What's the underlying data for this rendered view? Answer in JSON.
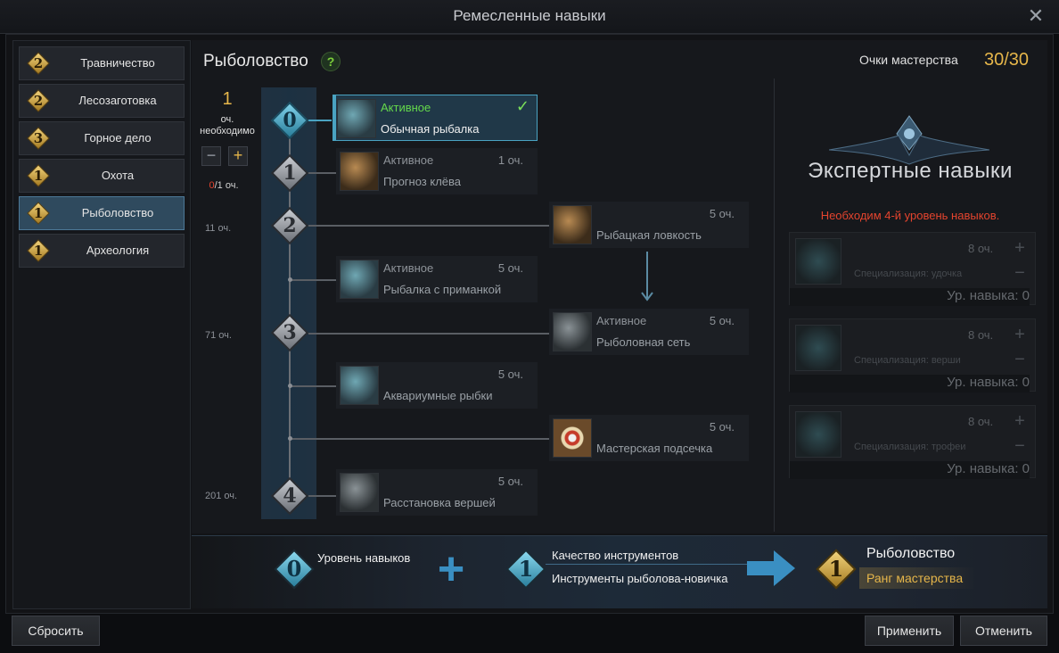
{
  "window": {
    "title": "Ремесленные навыки"
  },
  "sidebar": {
    "items": [
      {
        "level": "2",
        "label": "Травничество",
        "selected": false
      },
      {
        "level": "2",
        "label": "Лесозаготовка",
        "selected": false
      },
      {
        "level": "3",
        "label": "Горное дело",
        "selected": false
      },
      {
        "level": "1",
        "label": "Охота",
        "selected": false
      },
      {
        "level": "1",
        "label": "Рыболовство",
        "selected": true
      },
      {
        "level": "1",
        "label": "Археология",
        "selected": false
      }
    ]
  },
  "header": {
    "title": "Рыболовство",
    "help": "?",
    "mastery_label": "Очки мастерства",
    "mastery_value": "30/30"
  },
  "points": {
    "needed": "1",
    "needed_label": "оч. необходимо",
    "minus": "−",
    "plus": "+",
    "used_current": "0",
    "used_total": "/1 оч."
  },
  "tree": {
    "ranks": [
      "0",
      "1",
      "2",
      "3",
      "4"
    ],
    "requirements": [
      "11 оч.",
      "71 оч.",
      "201 оч."
    ],
    "skills": [
      {
        "type": "Активное",
        "name": "Обычная рыбалка",
        "cost": "",
        "active": true,
        "check": "✓"
      },
      {
        "type": "Активное",
        "name": "Прогноз клёва",
        "cost": "1 оч."
      },
      {
        "type": "",
        "name": "Рыбацкая ловкость",
        "cost": "5 оч."
      },
      {
        "type": "Активное",
        "name": "Рыбалка с приманкой",
        "cost": "5 оч."
      },
      {
        "type": "Активное",
        "name": "Рыболовная сеть",
        "cost": "5 оч."
      },
      {
        "type": "",
        "name": "Аквариумные рыбки",
        "cost": "5 оч."
      },
      {
        "type": "",
        "name": "Мастерская подсечка",
        "cost": "5 оч."
      },
      {
        "type": "",
        "name": "Расстановка вершей",
        "cost": "5 оч."
      }
    ]
  },
  "expert": {
    "title": "Экспертные навыки",
    "warning": "Необходим 4-й уровень навыков.",
    "cards": [
      {
        "cost": "8 оч.",
        "spec": "Специализация: удочка",
        "level": "Ур. навыка: 0",
        "plus": "+",
        "minus": "−"
      },
      {
        "cost": "8 оч.",
        "spec": "Специализация: верши",
        "level": "Ур. навыка: 0",
        "plus": "+",
        "minus": "−"
      },
      {
        "cost": "8 оч.",
        "spec": "Специализация: трофеи",
        "level": "Ур. навыка: 0",
        "plus": "+",
        "minus": "−"
      }
    ]
  },
  "summary": {
    "skill_level_value": "0",
    "skill_level_label": "Уровень навыков",
    "plus": "+",
    "tool_value": "1",
    "tool_label": "Качество инструментов",
    "tool_name": "Инструменты рыболова-новичка",
    "result_value": "1",
    "result_title": "Рыболовство",
    "result_rank": "Ранг мастерства"
  },
  "buttons": {
    "reset": "Сбросить",
    "apply": "Применить",
    "cancel": "Отменить"
  },
  "colors": {
    "gold": "#e6b64a",
    "active_green": "#64d94b",
    "warning_red": "#e4442e",
    "selection_blue": "#2f4a5e"
  }
}
